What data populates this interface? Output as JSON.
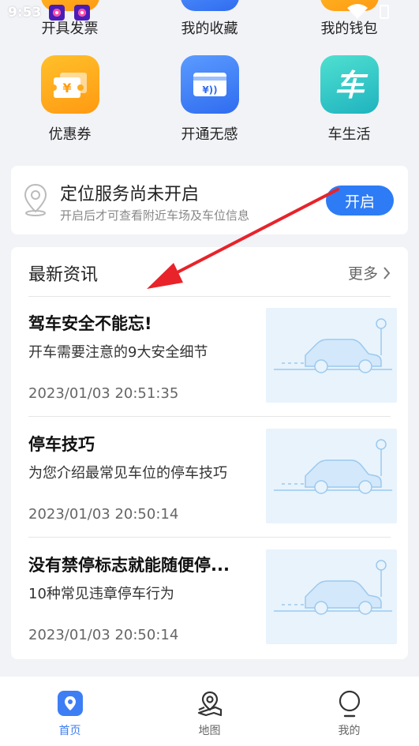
{
  "status_bar": {
    "time": "9:53"
  },
  "quick_menu": {
    "row0": [
      {
        "label": "开具发票",
        "icon": "invoice-icon"
      },
      {
        "label": "我的收藏",
        "icon": "favorites-icon"
      },
      {
        "label": "我的钱包",
        "icon": "wallet-icon"
      }
    ],
    "row1": [
      {
        "label": "优惠券",
        "icon": "coupon-icon"
      },
      {
        "label": "开通无感",
        "icon": "contactless-pay-icon"
      },
      {
        "label": "车生活",
        "icon": "car-life-icon"
      }
    ],
    "car_life_glyph": "车",
    "coupon_glyph": "¥",
    "contactless_glyph": "¥))"
  },
  "location_card": {
    "title": "定位服务尚未开启",
    "subtitle": "开启后才可查看附近车场及车位信息",
    "button_label": "开启"
  },
  "news": {
    "heading": "最新资讯",
    "more_label": "更多",
    "items": [
      {
        "title": "驾车安全不能忘!",
        "desc": "开车需要注意的9大安全细节",
        "time": "2023/01/03 20:51:35"
      },
      {
        "title": "停车技巧",
        "desc": "为您介绍最常见车位的停车技巧",
        "time": "2023/01/03 20:50:14"
      },
      {
        "title": "没有禁停标志就能随便停...",
        "desc": "10种常见违章停车行为",
        "time": "2023/01/03 20:50:14"
      }
    ]
  },
  "bottom_nav": [
    {
      "label": "首页",
      "icon": "home-icon",
      "active": true
    },
    {
      "label": "地图",
      "icon": "map-icon",
      "active": false
    },
    {
      "label": "我的",
      "icon": "profile-icon",
      "active": false
    }
  ],
  "colors": {
    "accent": "#2d7cf6",
    "annotation_arrow": "#e8232a",
    "background": "#f2f3f7"
  }
}
